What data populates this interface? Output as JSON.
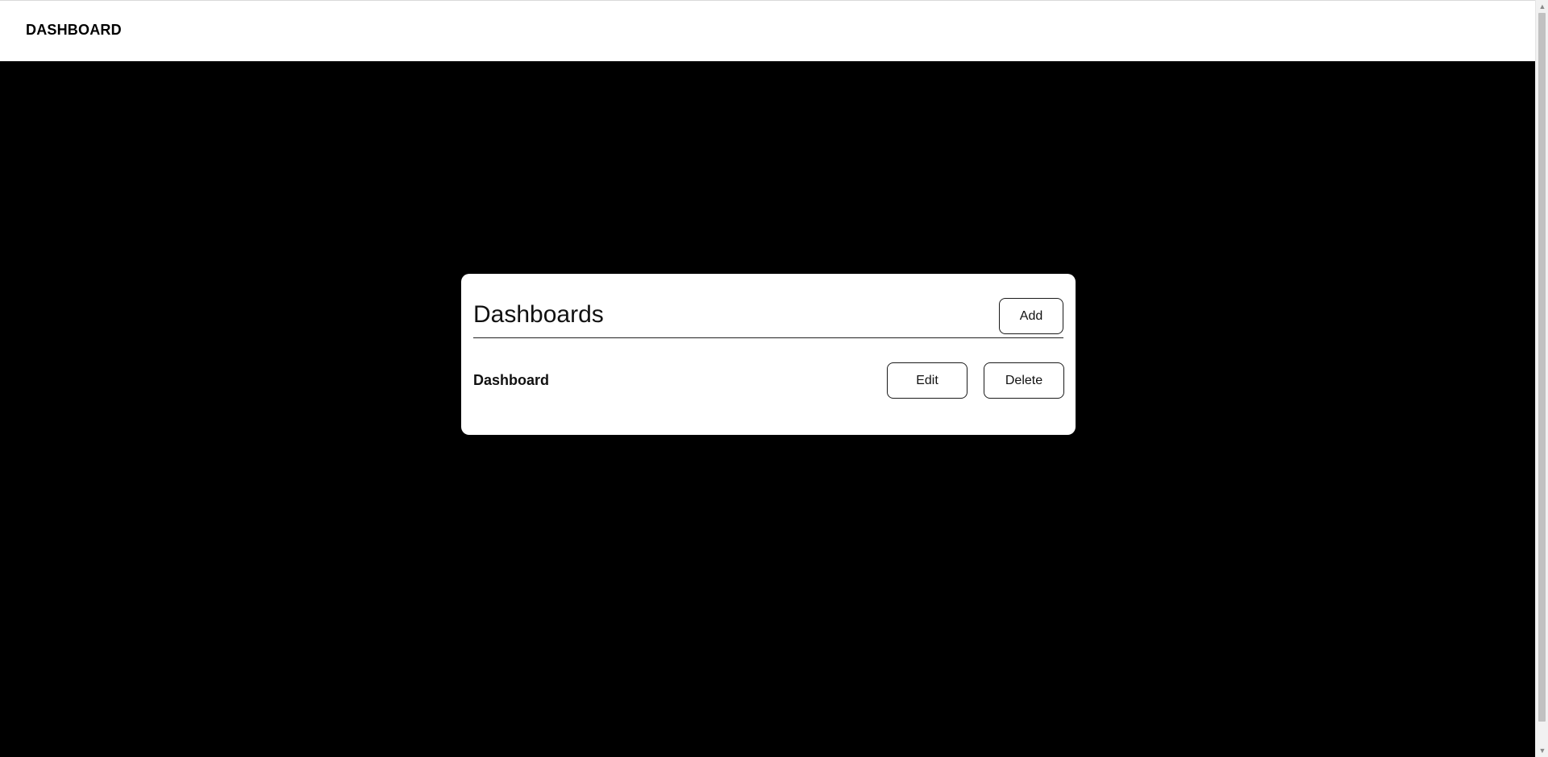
{
  "topbar": {
    "brand": "DASHBOARD"
  },
  "card": {
    "title": "Dashboards",
    "add_label": "Add",
    "items": [
      {
        "name": "Dashboard",
        "edit_label": "Edit",
        "delete_label": "Delete"
      }
    ]
  },
  "scrollbar": {
    "up_icon": "chevron-up-icon",
    "down_icon": "chevron-down-icon"
  },
  "colors": {
    "page_background": "#000000",
    "surface": "#ffffff",
    "text": "#111111",
    "border": "#1a1a1a"
  }
}
